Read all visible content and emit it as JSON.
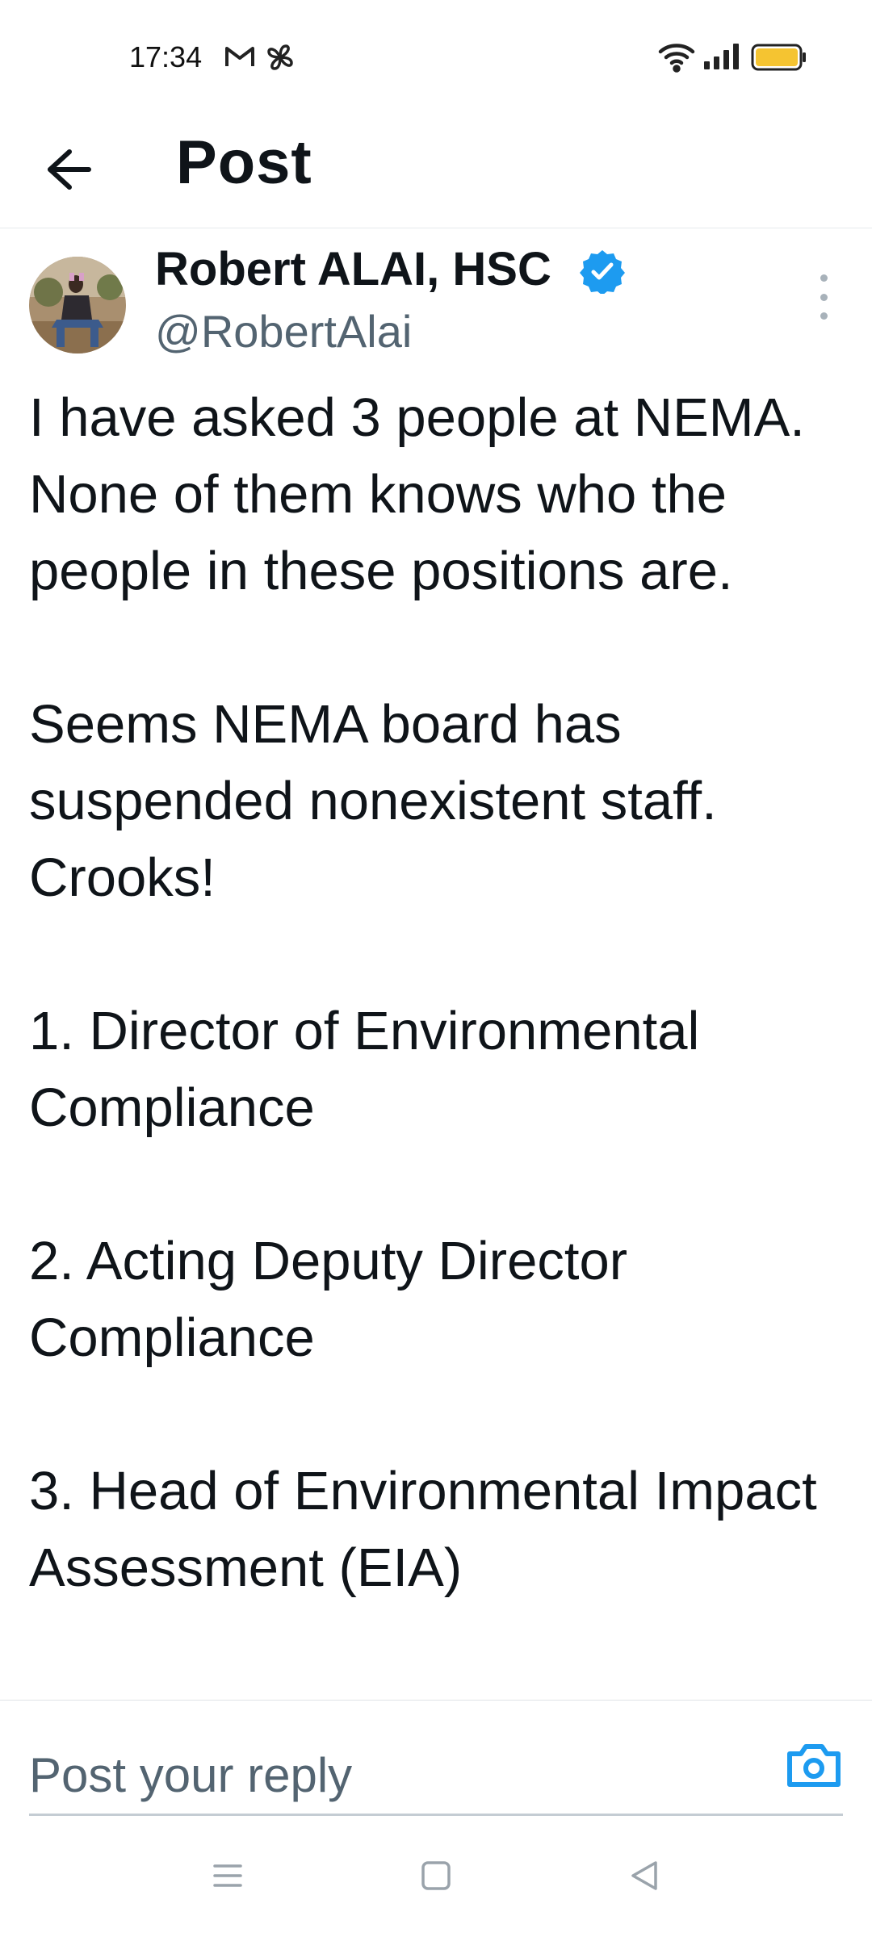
{
  "status_bar": {
    "time": "17:34",
    "left_icons": [
      "gmail-icon",
      "pinwheel-icon"
    ],
    "right_icons": [
      "wifi-icon",
      "signal-icon",
      "battery-icon"
    ],
    "battery_color": "#f5c431"
  },
  "header": {
    "title": "Post",
    "back_icon": "arrow-left-icon"
  },
  "post": {
    "author_name": "Robert ALAI, HSC",
    "handle": "@RobertAlai",
    "verified_color": "#1d9bf0",
    "paragraphs": [
      "I have asked 3 people at NEMA. None of them knows who the people in these positions are.",
      "Seems NEMA board has suspended nonexistent staff. Crooks!",
      "1. Director of Environmental Compliance",
      "2. Acting Deputy Director Compliance",
      "3. Head of Environmental Impact Assessment (EIA)"
    ]
  },
  "reply": {
    "placeholder": "Post your reply",
    "camera_icon": "camera-icon",
    "accent_color": "#1d9bf0"
  },
  "nav_bar": {
    "icons": [
      "menu-icon",
      "home-square-icon",
      "back-triangle-icon"
    ]
  }
}
